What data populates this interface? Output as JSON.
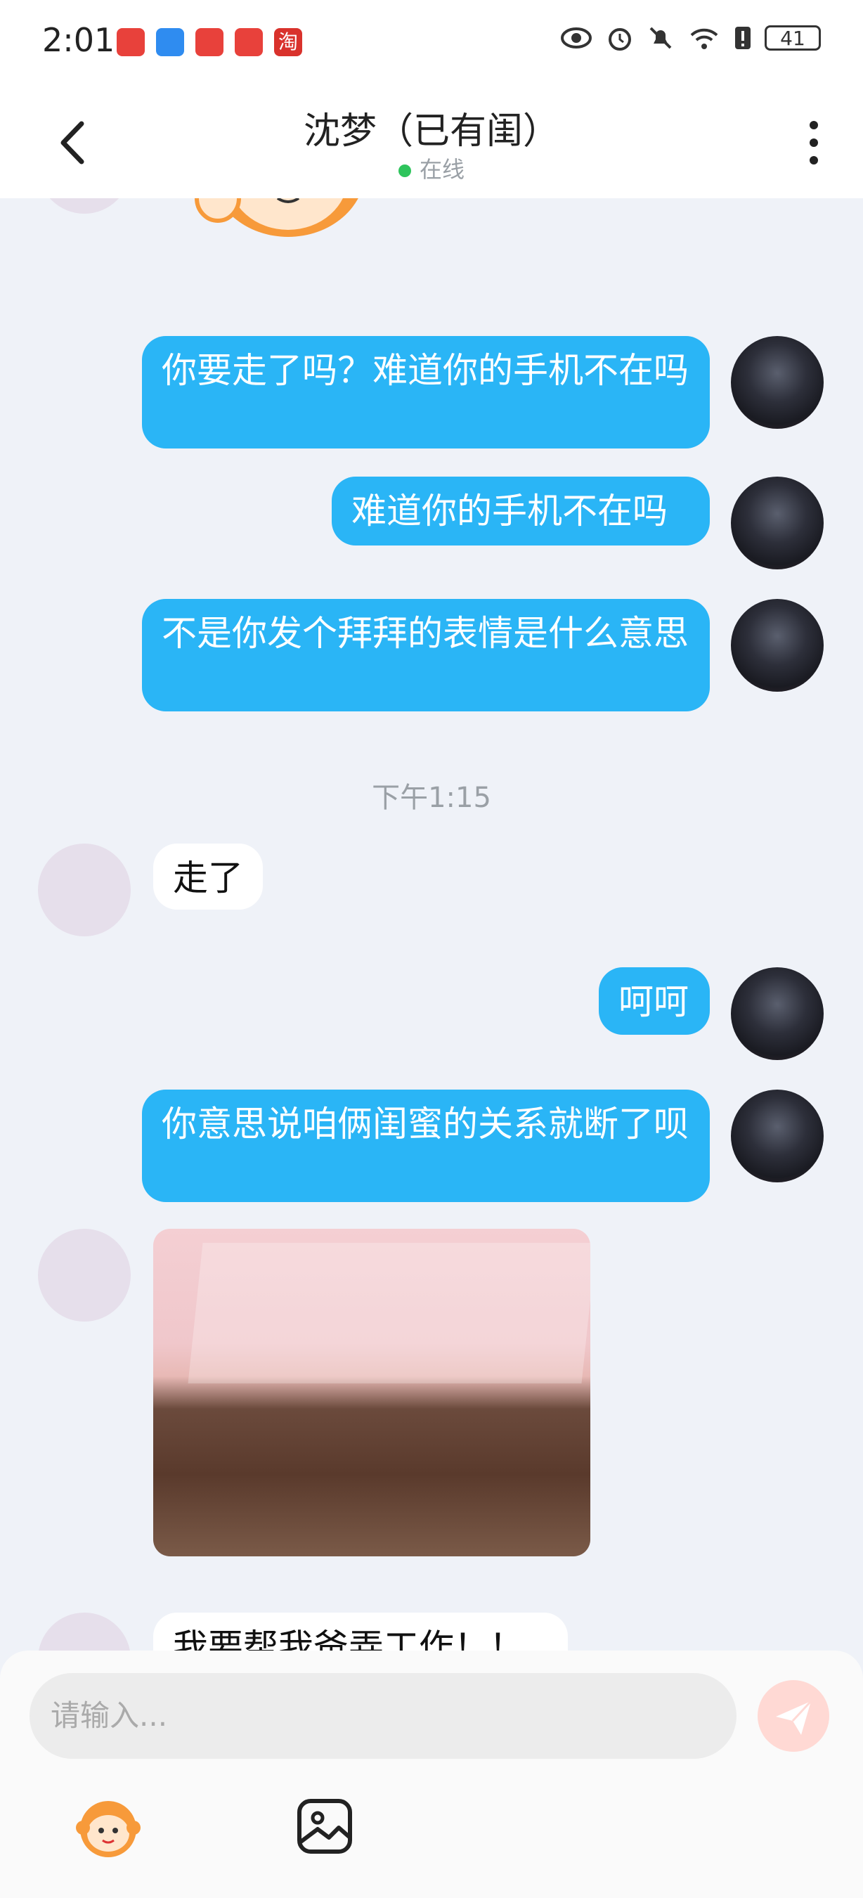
{
  "status_bar": {
    "time": "2:01",
    "battery": "41"
  },
  "header": {
    "title": "沈梦（已有闺）",
    "status": "在线"
  },
  "messages": [
    {
      "dir": "out",
      "text": "你要走了吗？难道你的手机不在吗"
    },
    {
      "dir": "out",
      "text": "难道你的手机不在吗"
    },
    {
      "dir": "out",
      "text": "不是你发个拜拜的表情是什么意思"
    },
    {
      "time": "下午1:15"
    },
    {
      "dir": "in",
      "text": "走了"
    },
    {
      "dir": "out",
      "text": "呵呵"
    },
    {
      "dir": "out",
      "text": "你意思说咱俩闺蜜的关系就断了呗"
    },
    {
      "dir": "in",
      "type": "image"
    },
    {
      "dir": "in",
      "text": "我要帮我爸弄工作！！"
    }
  ],
  "composer": {
    "placeholder": "请输入..."
  },
  "colors": {
    "sent_bubble": "#2ab5f6",
    "received_bubble": "#ffffff",
    "online_dot": "#2ec45c",
    "send_button": "#ffd9d4"
  },
  "icons": {
    "back": "chevron-left-icon",
    "more": "more-vertical-icon",
    "send": "send-icon",
    "sticker": "monkey-sticker-icon",
    "image": "image-icon"
  }
}
